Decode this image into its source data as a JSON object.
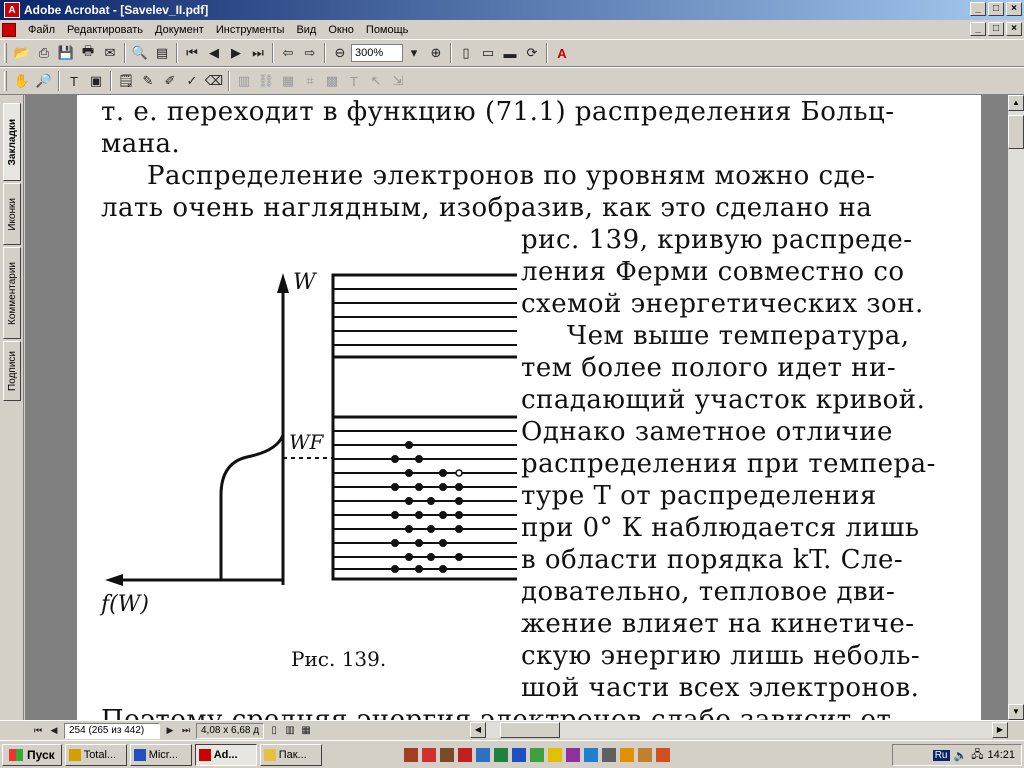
{
  "window": {
    "title": "Adobe Acrobat - [Savelev_II.pdf]",
    "controls": {
      "minimize": "_",
      "maximize": "□",
      "close": "×"
    }
  },
  "menu": [
    "Файл",
    "Редактировать",
    "Документ",
    "Инструменты",
    "Вид",
    "Окно",
    "Помощь"
  ],
  "toolbar": {
    "zoom": "300%"
  },
  "sidebar": {
    "tabs": [
      "Закладки",
      "Иконки",
      "Комментарии",
      "Подписи"
    ]
  },
  "document": {
    "lines": [
      "т. е. переходит в функцию (71.1) распределения Больц-",
      "мана.",
      "Распределение электронов по уровням можно сде-",
      "лать очень наглядным, изобразив, как это сделано на",
      "рис. 139, кривую распреде-",
      "ления Ферми совместно со",
      "схемой энергетических зон.",
      "Чем выше температура,",
      "тем более полого идет ни-",
      "спадающий участок кривой.",
      "Однако заметное отличие",
      "распределения при темпера-",
      "туре T от распределения",
      "при 0° К наблюдается лишь",
      "в области порядка kT. Сле-",
      "довательно, тепловое дви-",
      "жение влияет на кинетиче-",
      "скую энергию лишь неболь-",
      "шой части всех электронов.",
      "Поэтому средняя энергия электронов слабо зависит от"
    ],
    "figure": {
      "axis_w": "W",
      "axis_wf": "WF",
      "axis_f": "f(W)",
      "caption": "Рис. 139."
    }
  },
  "status": {
    "page": "254 (265 из 442)",
    "size": "4,08 x 6,68 д"
  },
  "taskbar": {
    "start": "Пуск",
    "tasks": [
      "Total...",
      "Micr...",
      "Ad...",
      "Пак..."
    ],
    "lang": "Ru",
    "clock": "14:21"
  }
}
